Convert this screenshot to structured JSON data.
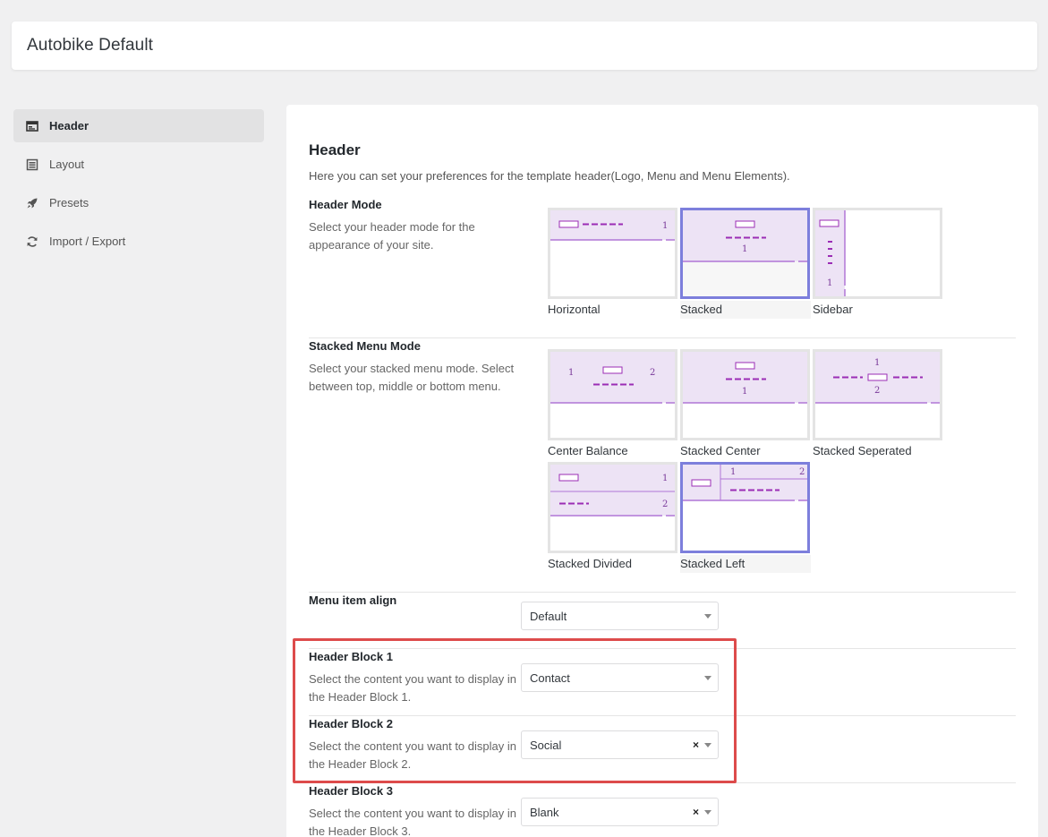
{
  "app": {
    "title": "Autobike Default"
  },
  "sidebar": {
    "items": [
      {
        "label": "Header",
        "icon": "header-icon",
        "active": true
      },
      {
        "label": "Layout",
        "icon": "layout-icon",
        "active": false
      },
      {
        "label": "Presets",
        "icon": "rocket-icon",
        "active": false
      },
      {
        "label": "Import / Export",
        "icon": "refresh-icon",
        "active": false
      }
    ]
  },
  "header_section": {
    "title": "Header",
    "description": "Here you can set your preferences for the template header(Logo, Menu and Menu Elements).",
    "header_mode": {
      "label": "Header Mode",
      "description": "Select your header mode for the appearance of your site.",
      "options": [
        {
          "caption": "Horizontal",
          "selected": false
        },
        {
          "caption": "Stacked",
          "selected": true
        },
        {
          "caption": "Sidebar",
          "selected": false
        }
      ]
    },
    "stacked_menu_mode": {
      "label": "Stacked Menu Mode",
      "description": "Select your stacked menu mode. Select between top, middle or bottom menu.",
      "options": [
        {
          "caption": "Center Balance",
          "selected": false
        },
        {
          "caption": "Stacked Center",
          "selected": false
        },
        {
          "caption": "Stacked Seperated",
          "selected": false
        },
        {
          "caption": "Stacked Divided",
          "selected": false
        },
        {
          "caption": "Stacked Left",
          "selected": true
        }
      ]
    },
    "menu_item_align": {
      "label": "Menu item align",
      "value": "Default"
    },
    "header_block_1": {
      "label": "Header Block 1",
      "description": "Select the content you want to display in the Header Block 1.",
      "value": "Contact"
    },
    "header_block_2": {
      "label": "Header Block 2",
      "description": "Select the content you want to display in the Header Block 2.",
      "value": "Social",
      "clear": "×"
    },
    "header_block_3": {
      "label": "Header Block 3",
      "description": "Select the content you want to display in the Header Block 3.",
      "value": "Blank",
      "clear": "×"
    },
    "thumb_numbers": {
      "one": "1",
      "two": "2"
    }
  },
  "colors": {
    "accent": "#7d7fdc",
    "thumb_fill": "#ede3f5",
    "thumb_line": "#b076d6",
    "thumb_dash": "#9b2db5",
    "highlight": "#dd4b4b"
  }
}
